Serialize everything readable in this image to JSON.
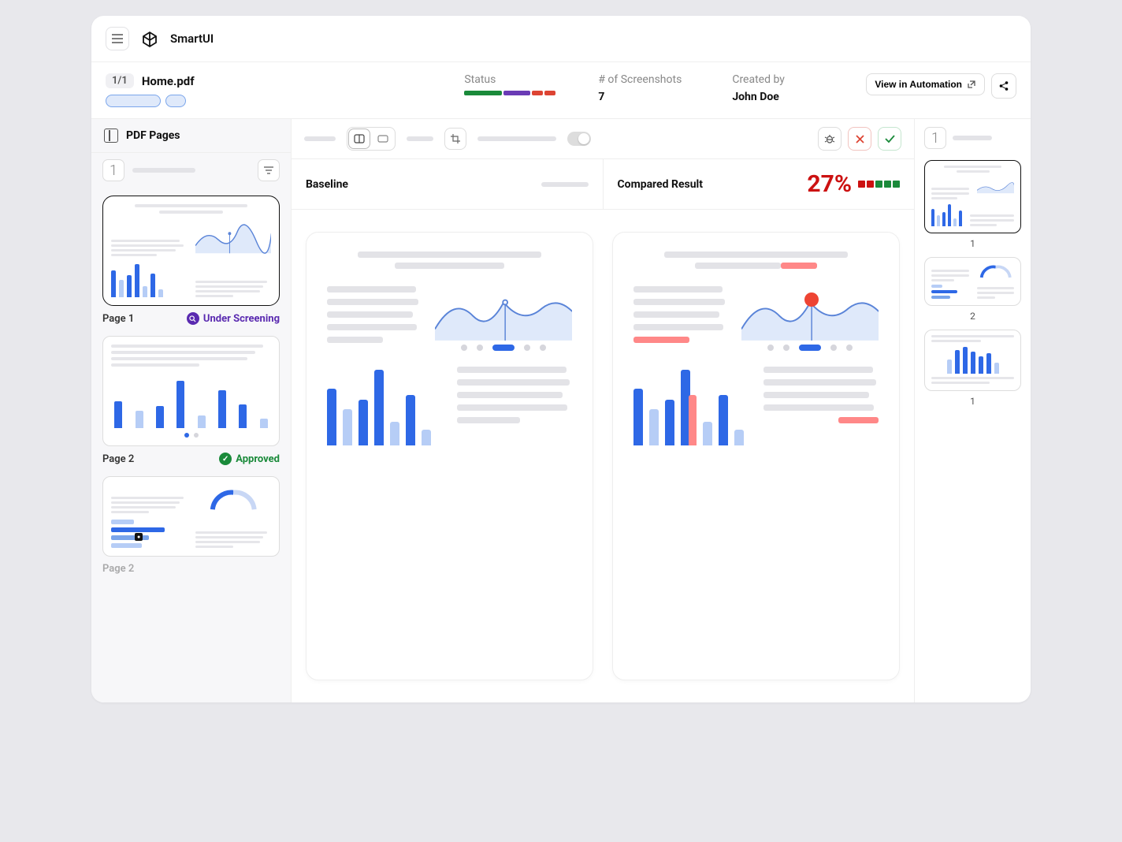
{
  "brand": "SmartUI",
  "file": {
    "counter": "1/1",
    "name": "Home.pdf"
  },
  "meta": {
    "status_label": "Status",
    "screenshots_label": "# of Screenshots",
    "screenshots_value": "7",
    "created_by_label": "Created by",
    "created_by_value": "John Doe"
  },
  "actions": {
    "view_automation": "View in Automation"
  },
  "left": {
    "title": "PDF Pages",
    "current_page": "1",
    "pages": [
      {
        "label": "Page 1",
        "status_text": "Under Screening",
        "status": "screening"
      },
      {
        "label": "Page 2",
        "status_text": "Approved",
        "status": "approved"
      },
      {
        "label": "Page 2",
        "status_text": "",
        "status": ""
      }
    ]
  },
  "compare": {
    "baseline_label": "Baseline",
    "compared_label": "Compared Result",
    "diff_percent": "27%"
  },
  "right": {
    "current": "1",
    "thumbs": [
      "1",
      "2",
      "1"
    ]
  },
  "status_colors": {
    "green": "#1a8a3a",
    "purple": "#6a3bb5",
    "red": "#dd4433"
  }
}
